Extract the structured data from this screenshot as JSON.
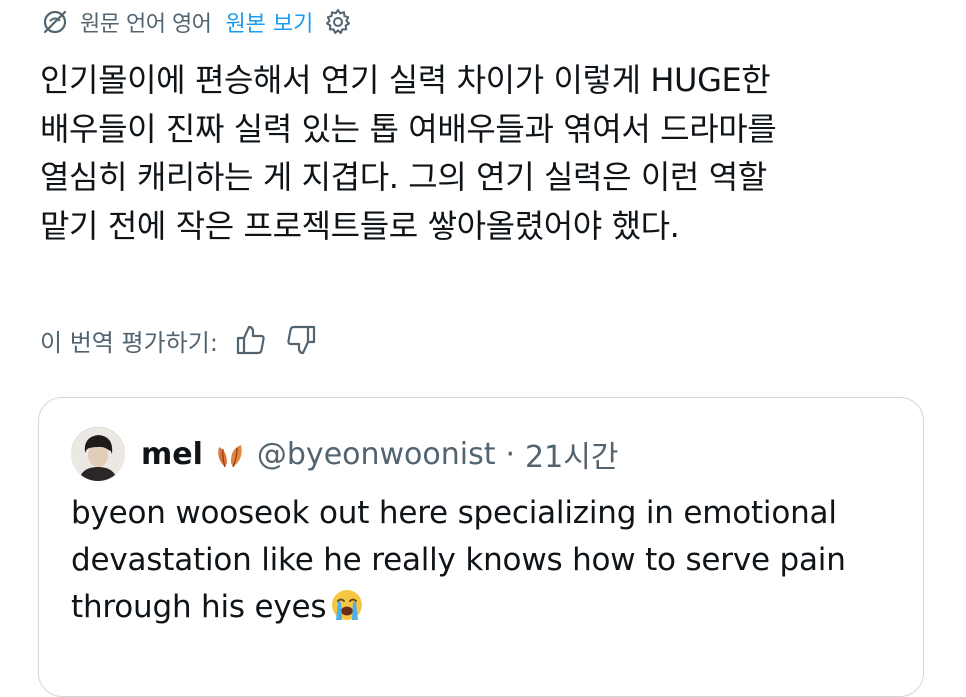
{
  "translation_bar": {
    "source_label": "원문 언어 영어",
    "show_original_label": "원본 보기"
  },
  "tweet": {
    "lines": [
      "인기몰이에 편승해서 연기 실력 차이가 이렇게 HUGE한",
      "배우들이 진짜 실력 있는 톱 여배우들과 엮여서 드라마를",
      "열심히 캐리하는 게 지겹다. 그의 연기 실력은 이런 역할",
      "맡기 전에 작은 프로젝트들로 쌓아올렸어야 했다."
    ]
  },
  "rate_translation": {
    "label": "이 번역 평가하기:"
  },
  "quote": {
    "name": "mel",
    "handle": "@byeonwoonist",
    "separator": "·",
    "time": "21시간",
    "lines": [
      "byeon wooseok out here specializing in emotional",
      "devastation like he really knows how to serve pain",
      "through his eyes"
    ]
  },
  "colors": {
    "text": "#0f1419",
    "secondary": "#536471",
    "link": "#1d9bf0",
    "border": "#cfd9de"
  },
  "icons": [
    "translate-off-icon",
    "gear-icon",
    "thumbs-up-icon",
    "thumbs-down-icon",
    "leaves-emoji",
    "loudly-crying-emoji"
  ]
}
